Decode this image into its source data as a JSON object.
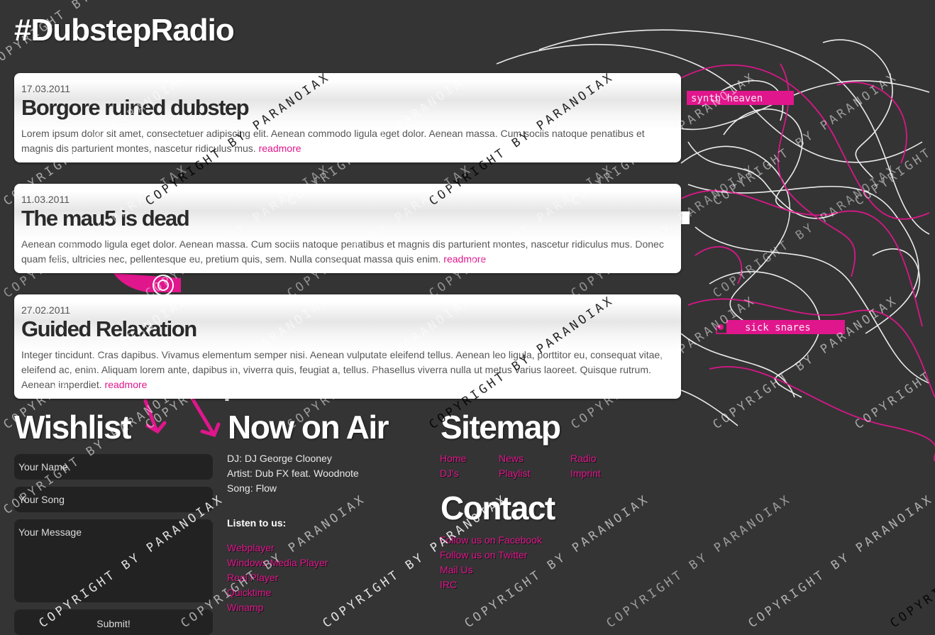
{
  "site": {
    "title": "#DubstepRadio"
  },
  "posts": [
    {
      "date": "17.03.2011",
      "title": "Borgore ruined dubstep",
      "body": "Lorem ipsum dolor sit amet, consectetuer adipiscing elit. Aenean commodo ligula eget dolor. Aenean massa. Cum sociis natoque penatibus et magnis dis parturient montes, nascetur ridiculus mus.",
      "readmore": "readmore"
    },
    {
      "date": "11.03.2011",
      "title": "The mau5 is dead",
      "body": "Aenean commodo ligula eget dolor. Aenean massa. Cum sociis natoque penatibus et magnis dis parturient montes, nascetur ridiculus mus. Donec quam felis, ultricies nec, pellentesque eu, pretium quis, sem. Nulla consequat massa quis enim.",
      "readmore": "readmore"
    },
    {
      "date": "27.02.2011",
      "title": "Guided Relaxation",
      "body": "Integer tincidunt. Cras dapibus. Vivamus elementum semper nisi. Aenean vulputate eleifend tellus. Aenean leo ligula, porttitor eu, consequat vitae, eleifend ac, enim. Aliquam lorem ante, dapibus in, viverra quis, feugiat a, tellus. Phasellus viverra nulla ut metus varius laoreet. Quisque rutrum. Aenean imperdiet.",
      "readmore": "readmore"
    }
  ],
  "artwork": {
    "tag_top": "synth heaven",
    "tag_bottom": "sick snares",
    "watermark": "COPYRIGHT BY PARANOIAX"
  },
  "wishlist": {
    "heading": "Wishlist",
    "name_placeholder": "Your Name",
    "song_placeholder": "Your Song",
    "message_placeholder": "Your Message",
    "submit_label": "Submit!"
  },
  "now_on_air": {
    "heading": "Now on Air",
    "dj": "DJ: DJ George Clooney",
    "artist": "Artist: Dub FX feat. Woodnote",
    "song": "Song: Flow",
    "listen_heading": "Listen to us:",
    "players": [
      "Webplayer",
      "Windows Media Player",
      "Real Player",
      "Quicktime",
      "Winamp"
    ]
  },
  "sitemap": {
    "heading": "Sitemap",
    "links": [
      "Home",
      "News",
      "Radio",
      "DJ's",
      "Playlist",
      "Imprint"
    ]
  },
  "contact": {
    "heading": "Contact",
    "links": [
      "Follow us on Facebook",
      "Follow us on Twitter",
      "Mail Us",
      "IRC"
    ]
  },
  "colors": {
    "background": "#343434",
    "accent_pink": "#e0168c",
    "card": "#ffffff",
    "field": "#222222"
  }
}
